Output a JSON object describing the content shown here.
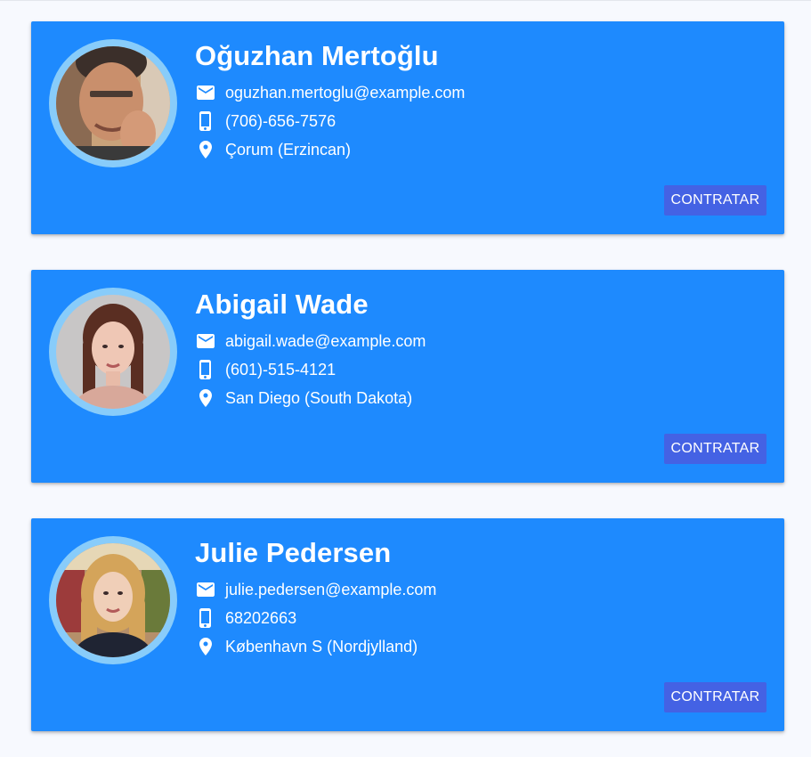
{
  "colors": {
    "card": "#1e8afe",
    "button": "#4462e4",
    "avatar_ring": "#88ccfa",
    "page_background": "#f7f9fe"
  },
  "icons": {
    "email": "email-icon",
    "phone": "phone-icon",
    "location": "location-pin-icon"
  },
  "contacts": [
    {
      "name": "Oğuzhan Mertoğlu",
      "email": "oguzhan.mertoglu@example.com",
      "phone": "(706)-656-7576",
      "location": "Çorum (Erzincan)",
      "button_label": "CONTRATAR"
    },
    {
      "name": "Abigail Wade",
      "email": "abigail.wade@example.com",
      "phone": "(601)-515-4121",
      "location": "San Diego (South Dakota)",
      "button_label": "CONTRATAR"
    },
    {
      "name": "Julie Pedersen",
      "email": "julie.pedersen@example.com",
      "phone": "68202663",
      "location": "København S (Nordjylland)",
      "button_label": "CONTRATAR"
    }
  ]
}
